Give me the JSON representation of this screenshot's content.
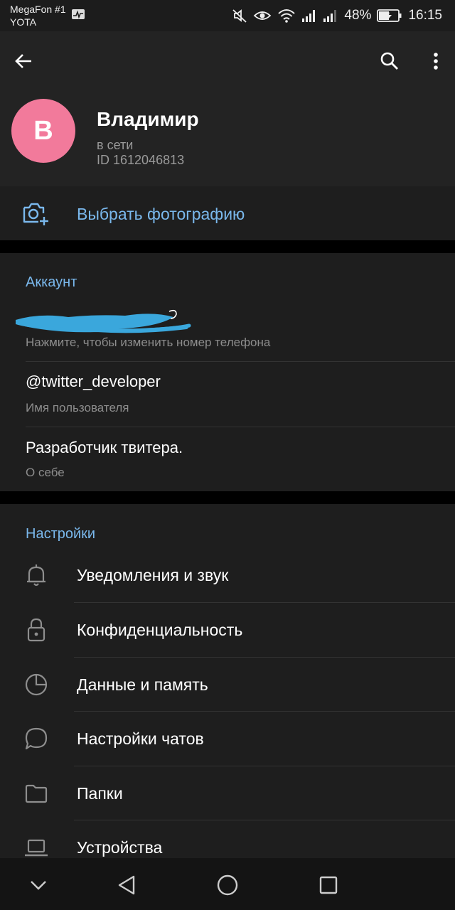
{
  "status_bar": {
    "carrier_1": "MegaFon #1",
    "carrier_2": "YOTA",
    "battery": "48%",
    "time": "16:15"
  },
  "profile": {
    "avatar_letter": "В",
    "avatar_color": "#f27a9b",
    "name": "Владимир",
    "status": "в сети",
    "id": "ID 1612046813"
  },
  "photo": {
    "label": "Выбрать фотографию",
    "accent": "#7ab8ec"
  },
  "account": {
    "header": "Аккаунт",
    "phone_hint": "Нажмите, чтобы изменить номер телефона",
    "username": "@twitter_developer",
    "username_hint": "Имя пользователя",
    "bio": "Разработчик твитера.",
    "bio_hint": "О себе"
  },
  "settings": {
    "header": "Настройки",
    "items": [
      {
        "icon": "bell-icon",
        "label": "Уведомления и звук"
      },
      {
        "icon": "lock-icon",
        "label": "Конфиденциальность"
      },
      {
        "icon": "pie-chart-icon",
        "label": "Данные и память"
      },
      {
        "icon": "chat-bubble-icon",
        "label": "Настройки чатов"
      },
      {
        "icon": "folder-icon",
        "label": "Папки"
      },
      {
        "icon": "laptop-icon",
        "label": "Устройства"
      }
    ]
  }
}
